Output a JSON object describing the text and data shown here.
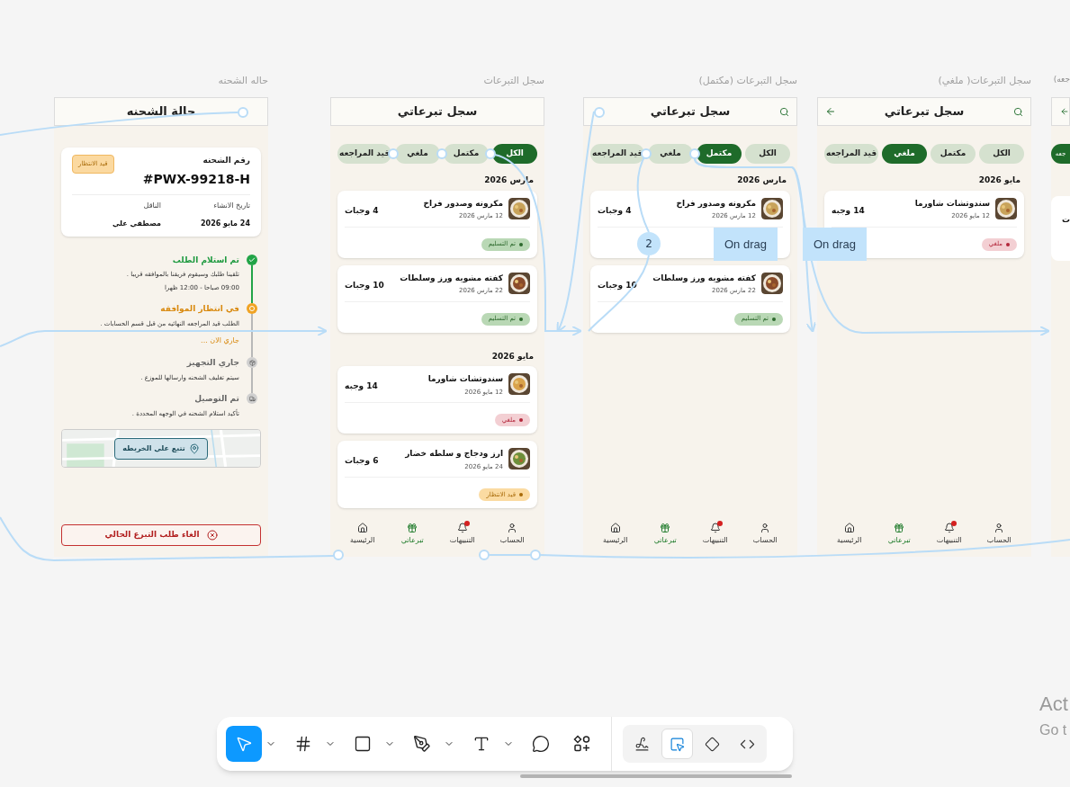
{
  "shipment_frame": {
    "label": "حاله الشحنه",
    "title": "حالة الشحنه",
    "card": {
      "number_label": "رقم الشحنه",
      "status": "قيد الانتظار",
      "number": "#PWX-99218-H",
      "fields": [
        {
          "label": "تاريخ الانشاء",
          "value": "24 مايو 2026"
        },
        {
          "label": "الناقل",
          "value": "مصطفي علي"
        }
      ]
    },
    "steps": [
      {
        "completed": true,
        "active": false,
        "title": "تم استلام الطلب",
        "desc": "تلقينا طلبك وسيقوم فريقنا بالموافقه قريبا .",
        "times": "09:00  صباحا  -  12:00  ظهرا"
      },
      {
        "completed": false,
        "active": true,
        "title": "في انتظار الموافقه",
        "desc": "الطلب قيد المراجعه النهائيه من قبل قسم الحسابات .",
        "note": "جاري الان ..."
      },
      {
        "kind": "preparing",
        "completed": false,
        "active": false,
        "title": "جاري التجهيز",
        "desc": "سيتم تغليف الشحنه وارسالها للموزع ."
      },
      {
        "kind": "delivery",
        "completed": false,
        "active": false,
        "title": "تم التوصيل",
        "desc": "تأكيد استلام الشحنه في الوجهه المحددة ."
      }
    ],
    "map_button": "تتبع علي الخريطه",
    "cancel_button": "الغاء طلب التبرع الحالي"
  },
  "log_frames": [
    {
      "label": "سجل التبرعات( ملغي)",
      "title": "سجل تبرعاتي",
      "search_icon": true,
      "back_icon": true,
      "chips": [
        {
          "label": "الكل",
          "selected": false
        },
        {
          "label": "مكتمل",
          "selected": false
        },
        {
          "label": "ملغي",
          "selected": true
        },
        {
          "label": "قيد المراجعه",
          "selected": false
        }
      ],
      "groups": [
        {
          "month": "مايو 2026",
          "items": [
            {
              "name": "سندوتشات شاورما",
              "date": "12 مايو 2026",
              "meals": "14 وجبه",
              "status": {
                "kind": "cancelled",
                "label": "ملغي"
              }
            }
          ]
        }
      ],
      "nav": [
        {
          "kind": "account",
          "label": "الحساب",
          "selected": false,
          "badge": false
        },
        {
          "kind": "notifications",
          "label": "التنبيهات",
          "selected": false,
          "badge": true
        },
        {
          "kind": "donations",
          "label": "تبرعاتي",
          "selected": true,
          "badge": false
        },
        {
          "kind": "home",
          "label": "الرئيسية",
          "selected": false,
          "badge": false
        }
      ]
    },
    {
      "label": "سجل التبرعات (مكتمل)",
      "title": "سجل تبرعاتي",
      "search_icon": true,
      "back_icon": false,
      "chips": [
        {
          "label": "الكل",
          "selected": false
        },
        {
          "label": "مكتمل",
          "selected": true
        },
        {
          "label": "ملغي",
          "selected": false
        },
        {
          "label": "قيد المراجعه",
          "selected": false
        }
      ],
      "groups": [
        {
          "month": "مارس 2026",
          "items": [
            {
              "name": "مكرونه وصدور فراخ",
              "date": "12 مارس 2026",
              "meals": "4 وجبات"
            },
            {
              "name": "كفته مشويه ورز وسلطات",
              "date": "22 مارس 2026",
              "meals": "10 وجبات",
              "status": {
                "kind": "delivered",
                "label": "تم التسليم"
              }
            }
          ]
        }
      ],
      "nav": [
        {
          "kind": "account",
          "label": "الحساب",
          "selected": false,
          "badge": false
        },
        {
          "kind": "notifications",
          "label": "التنبيهات",
          "selected": false,
          "badge": true
        },
        {
          "kind": "donations",
          "label": "تبرعاتي",
          "selected": true,
          "badge": false
        },
        {
          "kind": "home",
          "label": "الرئيسية",
          "selected": false,
          "badge": false
        }
      ]
    },
    {
      "label": "سجل التبرعات",
      "title": "سجل تبرعاتي",
      "search_icon": false,
      "back_icon": false,
      "chips": [
        {
          "label": "الكل",
          "selected": true
        },
        {
          "label": "مكتمل",
          "selected": false
        },
        {
          "label": "ملغي",
          "selected": false
        },
        {
          "label": "قيد المراجعه",
          "selected": false
        }
      ],
      "groups": [
        {
          "month": "مارس 2026",
          "items": [
            {
              "name": "مكرونه وصدور فراخ",
              "date": "12 مارس 2026",
              "meals": "4 وجبات",
              "status": {
                "kind": "delivered",
                "label": "تم التسليم"
              }
            },
            {
              "name": "كفته مشويه ورز وسلطات",
              "date": "22 مارس 2026",
              "meals": "10 وجبات",
              "status": {
                "kind": "delivered",
                "label": "تم التسليم"
              }
            }
          ]
        },
        {
          "month": "مايو 2026",
          "items": [
            {
              "name": "سندوتشات شاورما",
              "date": "12 مايو 2026",
              "meals": "14 وجبه",
              "status": {
                "kind": "cancelled",
                "label": "ملغي"
              }
            },
            {
              "name": "ارز ودجاج و سلطه خضار",
              "date": "24 مايو 2026",
              "meals": "6 وجبات",
              "status": {
                "kind": "pending",
                "label": "قيد الانتظار"
              }
            }
          ]
        }
      ],
      "nav": [
        {
          "kind": "account",
          "label": "الحساب",
          "selected": false,
          "badge": false
        },
        {
          "kind": "notifications",
          "label": "التنبيهات",
          "selected": false,
          "badge": true
        },
        {
          "kind": "donations",
          "label": "تبرعاتي",
          "selected": true,
          "badge": false
        },
        {
          "kind": "home",
          "label": "الرئيسية",
          "selected": false,
          "badge": false
        }
      ]
    }
  ],
  "partial_frame": {
    "label": "جعه)",
    "chip": "جعه",
    "card_text": "ت"
  },
  "connections": {
    "labels": [
      "On drag",
      "On drag"
    ],
    "badge": "2"
  },
  "toolbar": {
    "tools": [
      {
        "kind": "move",
        "selected": true,
        "dropdown": true
      },
      {
        "kind": "frame",
        "selected": false,
        "dropdown": true
      },
      {
        "kind": "rectangle",
        "selected": false,
        "dropdown": true
      },
      {
        "kind": "pen",
        "selected": false,
        "dropdown": true
      },
      {
        "kind": "text",
        "selected": false,
        "dropdown": true
      },
      {
        "kind": "comment",
        "selected": false,
        "dropdown": false
      },
      {
        "kind": "assets",
        "selected": false,
        "dropdown": false
      }
    ],
    "modes": [
      {
        "kind": "draw",
        "selected": false
      },
      {
        "kind": "design",
        "selected": true
      },
      {
        "kind": "component",
        "selected": false
      },
      {
        "kind": "code",
        "selected": false
      }
    ]
  },
  "os_notice": {
    "title": "Act",
    "subtitle": "Go t"
  }
}
